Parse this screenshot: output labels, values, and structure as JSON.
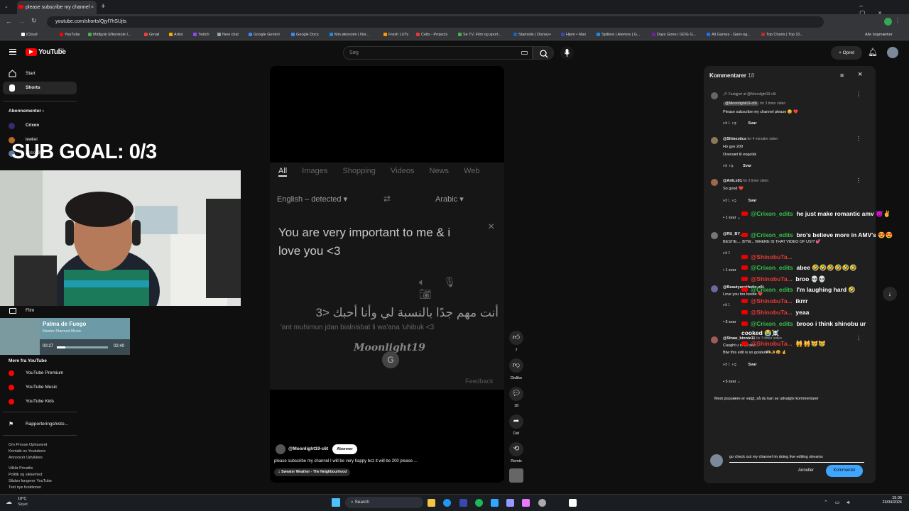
{
  "browser": {
    "tab_title": "please subscribe my channel",
    "new_tab": "+",
    "url": "youtube.com/shorts/Qjyf7hSUjts",
    "bookmarks": [
      "iCloud",
      "YouTube",
      "Midtjysk Efterskole I...",
      "Gmail",
      "Artist",
      "Twitch",
      "New chat",
      "Google Gemini",
      "Google Docs",
      "Min økonomi | Nor...",
      "Fresh LUTs",
      "Celtx - Projects",
      "Se TV, Film og sport...",
      "Startside | Disney+",
      "Hjem • Max",
      "Spillere | Atemos | G...",
      "Days Gone | GOG G...",
      "All Games - Gam-ng...",
      "Top Charts | Top 10..."
    ],
    "bookmark_colors": [
      "#ffffff",
      "#ff0000",
      "#4caf50",
      "#ea4335",
      "#f9ab00",
      "#9146ff",
      "#9aa0a6",
      "#4285f4",
      "#4285f4",
      "#1e88e5",
      "#ff9800",
      "#e53935",
      "#4caf50",
      "#1565c0",
      "#3949ab",
      "#1e88e5",
      "#7b1fa2",
      "#1a73e8",
      "#c62828"
    ],
    "all_bookmarks": "Alle bogmærker"
  },
  "youtube": {
    "logo": "YouTube",
    "country": "DK",
    "search_placeholder": "Søg",
    "create_label": "Opret",
    "sidebar": {
      "start": "Start",
      "shorts": "Shorts",
      "subscriptions": "Abonnementer",
      "subs": [
        "Crixon",
        "lewkei",
        "Sebo1337"
      ],
      "film": "Film",
      "more_title": "Mere fra YouTube",
      "more": [
        "YouTube Premium",
        "YouTube Music",
        "YouTube Kids"
      ],
      "report_history": "Rapporteringshisto...",
      "footer1": "Om  Presse  Ophavsret",
      "footer2": "Kontakt os  Youtubere",
      "footer3": "Annoncér  Udviklere",
      "footer4": "Vilkår  Privatliv",
      "footer5": "Politik og sikkerhed",
      "footer6": "Sådan fungerer YouTube",
      "footer7": "Test nye funktioner"
    },
    "short": {
      "translate_tabs": [
        "All",
        "Images",
        "Shopping",
        "Videos",
        "News",
        "Web"
      ],
      "source_lang": "English – detected",
      "target_lang": "Arabic",
      "source_text": "You are very important to me & i love you <3",
      "arabic_text": "أنت مهم جدًا بالنسبة لي وأنا أحبك <3",
      "transliteration": "'ant muhimun jdan bialnisbat li wa'ana 'uhibuk <3",
      "watermark": "Moonlight19",
      "feedback": "Feedback",
      "channel": "@Moonlight19-c6t",
      "subscribe": "Abonner",
      "description": "please subscribe my channel I will be very happy bcz it will be 200 please ...",
      "sound": "Sweater Weather - The Neighbourhood",
      "likes": "7",
      "dislike_label": "Dislike",
      "comments_count": "18",
      "share_label": "Del",
      "remix_label": "Remix"
    },
    "comments": {
      "title": "Kommentarer",
      "count": "18",
      "pinned": "Fastgjort af @Moonlight19-c6t",
      "list": [
        {
          "author": "@Moonlight19-c6t",
          "time": "for 3 timer siden",
          "text": "Please subscribe my channel please 😊 ❤️",
          "likes": "1",
          "reply": "Svar"
        },
        {
          "author": "@Shinextics",
          "time": "for 4 minutter siden",
          "text": "Ho gye 200",
          "extra": "Oversæt til engelsk",
          "reply": "Svar"
        },
        {
          "author": "@Ariii.x01",
          "time": "for 3 timer siden",
          "text": "So good ❤️",
          "likes": "1",
          "reply": "Svar",
          "replies": "1 svar"
        },
        {
          "author": "@RU_BY_...",
          "time": "for 3 timer siden",
          "text": "BESTIE.... BTW... WHERE IS THAT VIDEO OF US!? 💕",
          "likes": "2",
          "reply": "Svar",
          "replies": "1 svar"
        },
        {
          "author": "@Beautyaesthetic-x6t",
          "time": "for 3 timer siden",
          "text": "Love you too bestie ❤️",
          "likes": "1",
          "reply": "Svar",
          "replies": "5 svar"
        },
        {
          "author": "@Straw_binnie11",
          "time": "for 3 timer siden",
          "text": "Caught u in 50 sec...",
          "text2": "Btw this edit is so goated🫶🏻✨😝 🤞",
          "likes": "1",
          "reply": "Svar",
          "replies": "5 svar"
        }
      ],
      "sort_note": "Mest populære er valgt, så du kan se udvalgte kommentarer",
      "draft": "go check out my channel im doing live editing streams",
      "cancel": "Annuller",
      "submit": "Kommentér"
    }
  },
  "stream": {
    "sub_goal": "SUB GOAL: 0/3",
    "music_title": "Palma de Fuego",
    "music_artist": "Master Planned Music",
    "music_elapsed": "00:27",
    "music_total": "02:40",
    "music_progress": 0.17,
    "chat": [
      {
        "user": "@Crixon_edits",
        "msg": "he just make romantic amv 😈✌️"
      },
      {
        "user": "@Crixon_edits",
        "msg": "bro's believe more in AMV's 😍😍"
      },
      {
        "user": "@ShinobuTa...",
        "msg": ""
      },
      {
        "user": "@Crixon_edits",
        "msg": "abee 🤣🤣🤣🤣🤣🤣"
      },
      {
        "user": "@ShinobuTa...",
        "msg": "broo 💀💀"
      },
      {
        "user": "@Crixon_edits",
        "msg": "I'm laughing hard 🤣"
      },
      {
        "user": "@ShinobuTa...",
        "msg": "ikrrr"
      },
      {
        "user": "@ShinobuTa...",
        "msg": "yeaa"
      },
      {
        "user": "@Crixon_edits",
        "msg": "brooo i think shinobu ur cooked 😭☠️"
      },
      {
        "user": "@ShinobuTa...",
        "msg": "🙀🙀😿😿"
      }
    ]
  },
  "taskbar": {
    "temp": "10°C",
    "weather": "Skyet",
    "search": "Search",
    "time": "15.05",
    "date": "23/03/2026",
    "app_colors": [
      "#f4c542",
      "#2196f3",
      "#3949ab",
      "#1db954",
      "#31a8ff",
      "#9999ff",
      "#ea77ff",
      "#aaaaaa",
      "#ffffff"
    ]
  }
}
